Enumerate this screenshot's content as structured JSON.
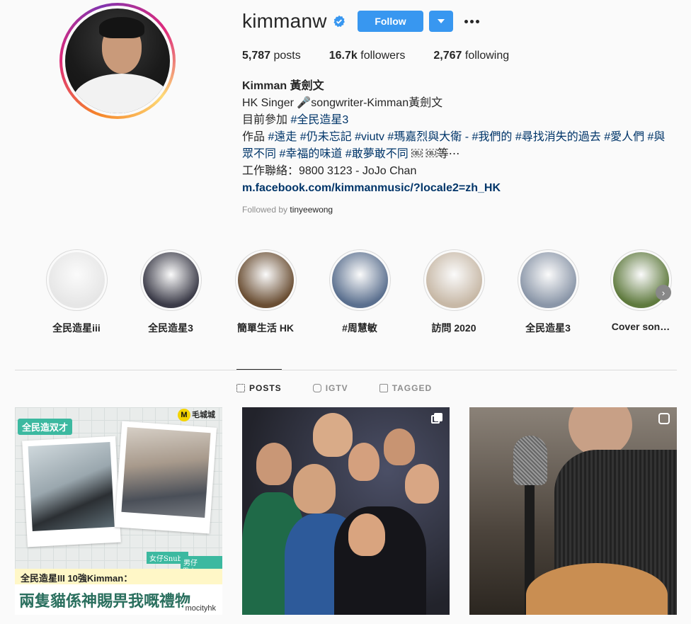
{
  "profile": {
    "username": "kimmanw",
    "follow_label": "Follow",
    "stats": {
      "posts_value": "5,787",
      "posts_label": "posts",
      "followers_value": "16.7k",
      "followers_label": "followers",
      "following_value": "2,767",
      "following_label": "following"
    },
    "bio": {
      "name": "Kimman 黃劍文",
      "line1": "HK Singer 🎤songwriter-Kimman黃劍文",
      "line2_prefix": "目前參加 ",
      "line2_tag": "#全民造星3",
      "line3_prefix": "作品 ",
      "line3_tags": "#遠走 #仍未忘記 #viutv #瑪嘉烈與大衛 - #我們的 #尋找消失的過去 #愛人們 #與",
      "line4_tags": "眾不同 #幸福的味道 #敢夢敢不同 ",
      "line4_suffix": "￼ ￼等⋯",
      "line5": "工作聯絡：9800 3123 - JoJo Chan",
      "link": "m.facebook.com/kimmanmusic/?locale2=zh_HK"
    },
    "followed_by_prefix": "Followed by ",
    "followed_by_user": "tinyeewong"
  },
  "highlights": [
    {
      "label": "全民造星iii",
      "color": "#e6e6e6"
    },
    {
      "label": "全民造星3",
      "color": "#3b3b48"
    },
    {
      "label": "簡單生活 HK",
      "color": "#6a4e33"
    },
    {
      "label": "#周慧敏",
      "color": "#5a6f8e"
    },
    {
      "label": "訪問 2020",
      "color": "#c7b8a6"
    },
    {
      "label": "全民造星3",
      "color": "#8a96a8"
    },
    {
      "label": "Cover son…",
      "color": "#5f7a3e"
    }
  ],
  "tabs": [
    {
      "label": "POSTS",
      "active": true
    },
    {
      "label": "IGTV",
      "active": false
    },
    {
      "label": "TAGGED",
      "active": false
    }
  ],
  "posts": {
    "p1": {
      "badge": "全民造双才",
      "logo": "毛城城",
      "caption1": "全民造星III 10強Kimman：",
      "caption2": "兩隻貓係神賜畀我嘅禮物",
      "cat1": "女仔Snubs",
      "cat2": "男仔Tripper",
      "credit": "mocityhk"
    }
  },
  "colors": {
    "accent": "#3897f0",
    "link": "#003569"
  }
}
